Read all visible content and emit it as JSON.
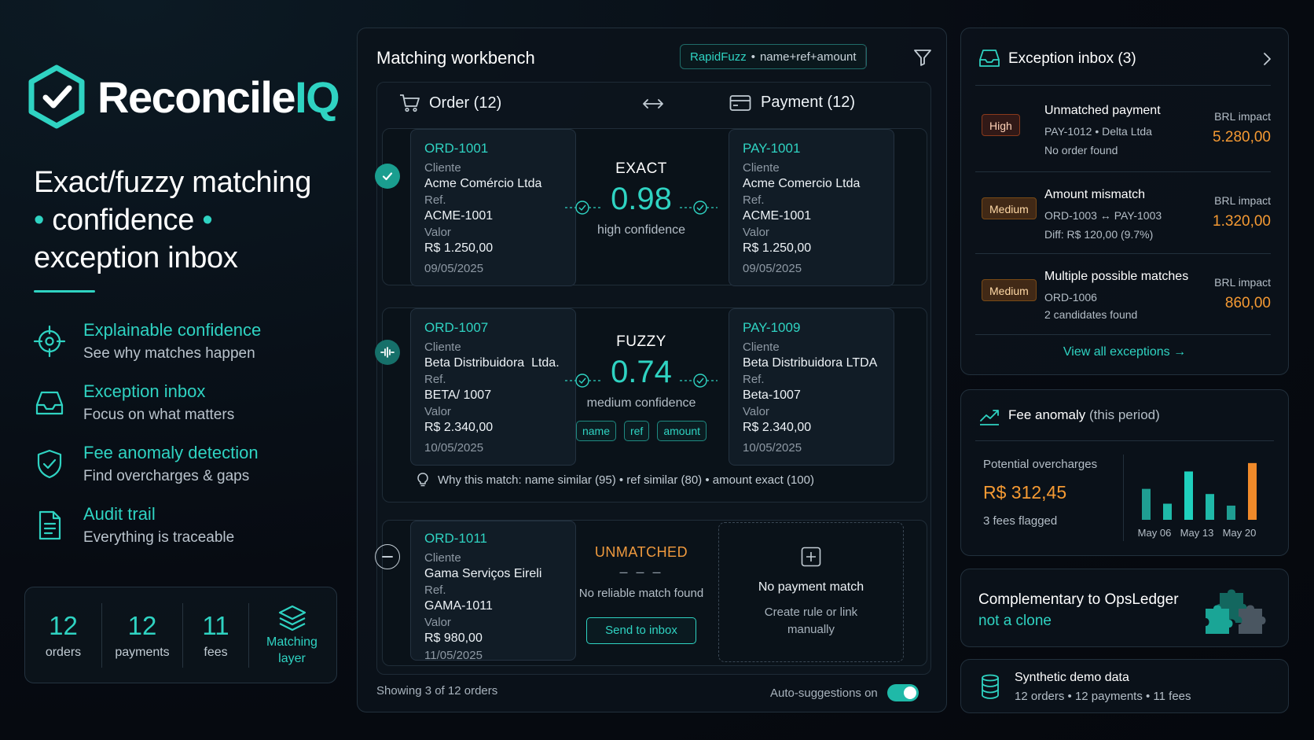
{
  "brand": {
    "name_main": "Reconcile",
    "name_accent": "IQ"
  },
  "headline": {
    "line1": "Exact/fuzzy matching",
    "line2": "confidence",
    "line3": "exception inbox",
    "bullet": "•"
  },
  "features": [
    {
      "title": "Explainable confidence",
      "subtitle": "See why matches happen",
      "icon": "target-icon"
    },
    {
      "title": "Exception inbox",
      "subtitle": "Focus on what matters",
      "icon": "inbox-icon"
    },
    {
      "title": "Fee anomaly detection",
      "subtitle": "Find overcharges & gaps",
      "icon": "shield-check-icon"
    },
    {
      "title": "Audit trail",
      "subtitle": "Everything is traceable",
      "icon": "document-icon"
    }
  ],
  "stats": [
    {
      "value": "12",
      "label": "orders"
    },
    {
      "value": "12",
      "label": "payments"
    },
    {
      "value": "11",
      "label": "fees"
    }
  ],
  "stats_layer": {
    "line1": "Matching",
    "line2": "layer"
  },
  "workbench": {
    "title": "Matching workbench",
    "algo": "RapidFuzz",
    "algo_sep": "•",
    "algo_fields": "name+ref+amount",
    "order_header": "Order (12)",
    "payment_header": "Payment (12)",
    "field_labels": {
      "client": "Cliente",
      "ref": "Ref.",
      "value": "Valor"
    },
    "pairs": [
      {
        "order": {
          "id": "ORD-1001",
          "client": "Acme Comércio Ltda",
          "ref": "ACME-1001",
          "value": "R$ 1.250,00",
          "date": "09/05/2025"
        },
        "payment": {
          "id": "PAY-1001",
          "client": "Acme Comercio Ltda",
          "ref": "ACME-1001",
          "value": "R$ 1.250,00",
          "date": "09/05/2025"
        },
        "type": "EXACT",
        "score": "0.98",
        "confidence": "high confidence"
      },
      {
        "order": {
          "id": "ORD-1007",
          "client": "Beta Distribuidora  Ltda.",
          "ref": "BETA/ 1007",
          "value": "R$ 2.340,00",
          "date": "10/05/2025"
        },
        "payment": {
          "id": "PAY-1009",
          "client": "Beta Distribuidora LTDA",
          "ref": "Beta-1007",
          "value": "R$ 2.340,00",
          "date": "10/05/2025"
        },
        "type": "FUZZY",
        "score": "0.74",
        "confidence": "medium confidence",
        "tags": [
          "name",
          "ref",
          "amount"
        ],
        "why": "Why this match: name similar (95) • ref similar (80) • amount exact (100)"
      },
      {
        "order": {
          "id": "ORD-1011",
          "client": "Gama Serviços Eireli",
          "ref": "GAMA-1011",
          "value": "R$ 980,00",
          "date": "11/05/2025"
        },
        "type": "UNMATCHED",
        "dashes": "– – –",
        "note": "No reliable match found",
        "action": "Send to inbox",
        "no_payment_title": "No payment match",
        "no_payment_line1": "Create rule or link",
        "no_payment_line2": "manually"
      }
    ],
    "footer_left": "Showing 3 of 12 orders",
    "footer_right": "Auto-suggestions on",
    "auto_suggestions_on": true
  },
  "inbox": {
    "title": "Exception inbox (3)",
    "items": [
      {
        "severity": "High",
        "title": "Unmatched payment",
        "line1": "PAY-1012 • Delta Ltda",
        "line2": "No order found",
        "impact_label": "BRL impact",
        "impact": "5.280,00"
      },
      {
        "severity": "Medium",
        "title": "Amount mismatch",
        "line1": "ORD-1003 ↔ PAY-1003",
        "line2": "Diff: R$ 120,00 (9.7%)",
        "impact_label": "BRL impact",
        "impact": "1.320,00"
      },
      {
        "severity": "Medium",
        "title": "Multiple possible matches",
        "line1": "ORD-1006",
        "line2": "2 candidates found",
        "impact_label": "BRL impact",
        "impact": "860,00"
      }
    ],
    "view_all": "View all exceptions →"
  },
  "fee": {
    "title": "Fee anomaly",
    "period": "(this period)",
    "label": "Potential overcharges",
    "amount": "R$ 312,45",
    "flagged": "3 fees flagged",
    "chart_data": {
      "type": "bar",
      "x_tick_labels": [
        "May 06",
        "May 13",
        "May 20"
      ],
      "values": [
        0.48,
        0.25,
        0.75,
        0.4,
        0.22,
        0.88
      ],
      "colors": [
        "#1f9e92",
        "#1fb9a8",
        "#1fd0bd",
        "#1fb9a8",
        "#1f9e92",
        "#f08a2a"
      ]
    }
  },
  "complement": {
    "title": "Complementary to OpsLedger",
    "subtitle": "not a clone"
  },
  "synthetic": {
    "title": "Synthetic demo data",
    "subtitle": "12 orders • 12 payments • 11 fees"
  }
}
